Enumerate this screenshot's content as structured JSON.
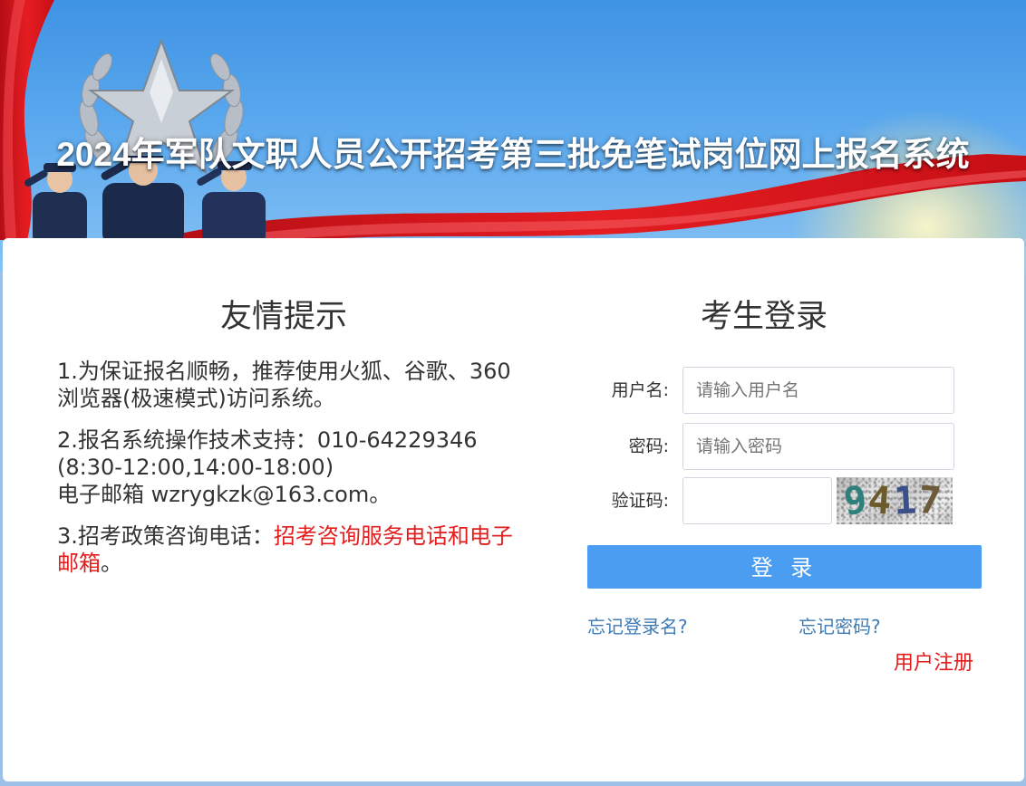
{
  "header": {
    "title": "2024年军队文职人员公开招考第三批免笔试岗位网上报名系统"
  },
  "tips": {
    "title": "友情提示",
    "item1": "1.为保证报名顺畅，推荐使用火狐、谷歌、360浏览器(极速模式)访问系统。",
    "item2_line1": "2.报名系统操作技术支持：010-64229346",
    "item2_line2": "(8:30-12:00,14:00-18:00)",
    "item2_line3": "电子邮箱  wzrygkzk@163.com。",
    "item3_prefix": "3.招考政策咨询电话：",
    "item3_link": "招考咨询服务电话和电子邮箱",
    "item3_suffix": "。"
  },
  "login": {
    "title": "考生登录",
    "username_label": "用户名:",
    "username_placeholder": "请输入用户名",
    "password_label": "密码:",
    "password_placeholder": "请输入密码",
    "captcha_label": "验证码:",
    "captcha_value": "",
    "captcha_digits": [
      "9",
      "4",
      "1",
      "7"
    ],
    "login_button": "登 录",
    "forgot_username": "忘记登录名?",
    "forgot_password": "忘记密码?",
    "register": "用户注册"
  },
  "colors": {
    "banner_blue": "#4a9be8",
    "flag_red": "#d8121b",
    "button_blue": "#4a9df0",
    "link_blue": "#3e7bb6",
    "alert_red": "#e31c1c"
  }
}
